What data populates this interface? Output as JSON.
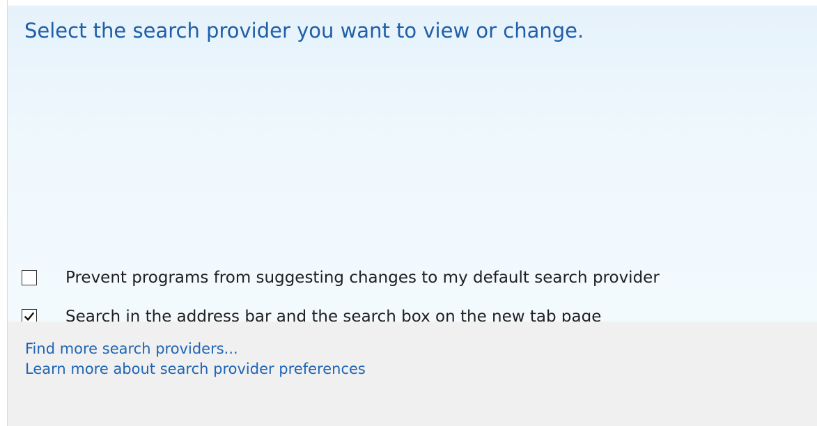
{
  "header": {
    "title": "Select the search provider you want to view or change."
  },
  "provider_list": {
    "items": []
  },
  "options": [
    {
      "label": "Prevent programs from suggesting changes to my default search provider",
      "checked": false
    },
    {
      "label": "Search in the address bar and the search box on the new tab page",
      "checked": true
    }
  ],
  "footer": {
    "links": [
      {
        "label": "Find more search providers..."
      },
      {
        "label": "Learn more about search provider preferences"
      }
    ]
  },
  "colors": {
    "heading": "#1f5fa8",
    "link": "#1f64b4",
    "panel": "#eff8fd",
    "footer": "#f0f0f0"
  },
  "icons": {
    "checked_icon": "checkmark-icon"
  }
}
